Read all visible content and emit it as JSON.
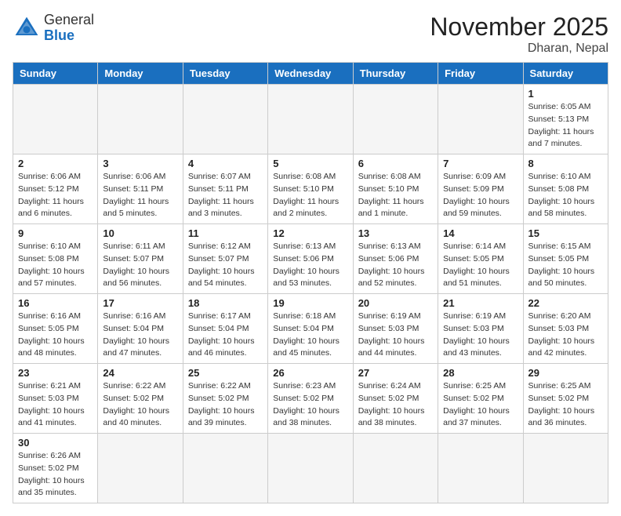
{
  "header": {
    "title": "November 2025",
    "location": "Dharan, Nepal",
    "logo_general": "General",
    "logo_blue": "Blue"
  },
  "weekdays": [
    "Sunday",
    "Monday",
    "Tuesday",
    "Wednesday",
    "Thursday",
    "Friday",
    "Saturday"
  ],
  "weeks": [
    [
      {
        "day": "",
        "sunrise": "",
        "sunset": "",
        "daylight": ""
      },
      {
        "day": "",
        "sunrise": "",
        "sunset": "",
        "daylight": ""
      },
      {
        "day": "",
        "sunrise": "",
        "sunset": "",
        "daylight": ""
      },
      {
        "day": "",
        "sunrise": "",
        "sunset": "",
        "daylight": ""
      },
      {
        "day": "",
        "sunrise": "",
        "sunset": "",
        "daylight": ""
      },
      {
        "day": "",
        "sunrise": "",
        "sunset": "",
        "daylight": ""
      },
      {
        "day": "1",
        "sunrise": "Sunrise: 6:05 AM",
        "sunset": "Sunset: 5:13 PM",
        "daylight": "Daylight: 11 hours and 7 minutes."
      }
    ],
    [
      {
        "day": "2",
        "sunrise": "Sunrise: 6:06 AM",
        "sunset": "Sunset: 5:12 PM",
        "daylight": "Daylight: 11 hours and 6 minutes."
      },
      {
        "day": "3",
        "sunrise": "Sunrise: 6:06 AM",
        "sunset": "Sunset: 5:11 PM",
        "daylight": "Daylight: 11 hours and 5 minutes."
      },
      {
        "day": "4",
        "sunrise": "Sunrise: 6:07 AM",
        "sunset": "Sunset: 5:11 PM",
        "daylight": "Daylight: 11 hours and 3 minutes."
      },
      {
        "day": "5",
        "sunrise": "Sunrise: 6:08 AM",
        "sunset": "Sunset: 5:10 PM",
        "daylight": "Daylight: 11 hours and 2 minutes."
      },
      {
        "day": "6",
        "sunrise": "Sunrise: 6:08 AM",
        "sunset": "Sunset: 5:10 PM",
        "daylight": "Daylight: 11 hours and 1 minute."
      },
      {
        "day": "7",
        "sunrise": "Sunrise: 6:09 AM",
        "sunset": "Sunset: 5:09 PM",
        "daylight": "Daylight: 10 hours and 59 minutes."
      },
      {
        "day": "8",
        "sunrise": "Sunrise: 6:10 AM",
        "sunset": "Sunset: 5:08 PM",
        "daylight": "Daylight: 10 hours and 58 minutes."
      }
    ],
    [
      {
        "day": "9",
        "sunrise": "Sunrise: 6:10 AM",
        "sunset": "Sunset: 5:08 PM",
        "daylight": "Daylight: 10 hours and 57 minutes."
      },
      {
        "day": "10",
        "sunrise": "Sunrise: 6:11 AM",
        "sunset": "Sunset: 5:07 PM",
        "daylight": "Daylight: 10 hours and 56 minutes."
      },
      {
        "day": "11",
        "sunrise": "Sunrise: 6:12 AM",
        "sunset": "Sunset: 5:07 PM",
        "daylight": "Daylight: 10 hours and 54 minutes."
      },
      {
        "day": "12",
        "sunrise": "Sunrise: 6:13 AM",
        "sunset": "Sunset: 5:06 PM",
        "daylight": "Daylight: 10 hours and 53 minutes."
      },
      {
        "day": "13",
        "sunrise": "Sunrise: 6:13 AM",
        "sunset": "Sunset: 5:06 PM",
        "daylight": "Daylight: 10 hours and 52 minutes."
      },
      {
        "day": "14",
        "sunrise": "Sunrise: 6:14 AM",
        "sunset": "Sunset: 5:05 PM",
        "daylight": "Daylight: 10 hours and 51 minutes."
      },
      {
        "day": "15",
        "sunrise": "Sunrise: 6:15 AM",
        "sunset": "Sunset: 5:05 PM",
        "daylight": "Daylight: 10 hours and 50 minutes."
      }
    ],
    [
      {
        "day": "16",
        "sunrise": "Sunrise: 6:16 AM",
        "sunset": "Sunset: 5:05 PM",
        "daylight": "Daylight: 10 hours and 48 minutes."
      },
      {
        "day": "17",
        "sunrise": "Sunrise: 6:16 AM",
        "sunset": "Sunset: 5:04 PM",
        "daylight": "Daylight: 10 hours and 47 minutes."
      },
      {
        "day": "18",
        "sunrise": "Sunrise: 6:17 AM",
        "sunset": "Sunset: 5:04 PM",
        "daylight": "Daylight: 10 hours and 46 minutes."
      },
      {
        "day": "19",
        "sunrise": "Sunrise: 6:18 AM",
        "sunset": "Sunset: 5:04 PM",
        "daylight": "Daylight: 10 hours and 45 minutes."
      },
      {
        "day": "20",
        "sunrise": "Sunrise: 6:19 AM",
        "sunset": "Sunset: 5:03 PM",
        "daylight": "Daylight: 10 hours and 44 minutes."
      },
      {
        "day": "21",
        "sunrise": "Sunrise: 6:19 AM",
        "sunset": "Sunset: 5:03 PM",
        "daylight": "Daylight: 10 hours and 43 minutes."
      },
      {
        "day": "22",
        "sunrise": "Sunrise: 6:20 AM",
        "sunset": "Sunset: 5:03 PM",
        "daylight": "Daylight: 10 hours and 42 minutes."
      }
    ],
    [
      {
        "day": "23",
        "sunrise": "Sunrise: 6:21 AM",
        "sunset": "Sunset: 5:03 PM",
        "daylight": "Daylight: 10 hours and 41 minutes."
      },
      {
        "day": "24",
        "sunrise": "Sunrise: 6:22 AM",
        "sunset": "Sunset: 5:02 PM",
        "daylight": "Daylight: 10 hours and 40 minutes."
      },
      {
        "day": "25",
        "sunrise": "Sunrise: 6:22 AM",
        "sunset": "Sunset: 5:02 PM",
        "daylight": "Daylight: 10 hours and 39 minutes."
      },
      {
        "day": "26",
        "sunrise": "Sunrise: 6:23 AM",
        "sunset": "Sunset: 5:02 PM",
        "daylight": "Daylight: 10 hours and 38 minutes."
      },
      {
        "day": "27",
        "sunrise": "Sunrise: 6:24 AM",
        "sunset": "Sunset: 5:02 PM",
        "daylight": "Daylight: 10 hours and 38 minutes."
      },
      {
        "day": "28",
        "sunrise": "Sunrise: 6:25 AM",
        "sunset": "Sunset: 5:02 PM",
        "daylight": "Daylight: 10 hours and 37 minutes."
      },
      {
        "day": "29",
        "sunrise": "Sunrise: 6:25 AM",
        "sunset": "Sunset: 5:02 PM",
        "daylight": "Daylight: 10 hours and 36 minutes."
      }
    ],
    [
      {
        "day": "30",
        "sunrise": "Sunrise: 6:26 AM",
        "sunset": "Sunset: 5:02 PM",
        "daylight": "Daylight: 10 hours and 35 minutes."
      },
      {
        "day": "",
        "sunrise": "",
        "sunset": "",
        "daylight": ""
      },
      {
        "day": "",
        "sunrise": "",
        "sunset": "",
        "daylight": ""
      },
      {
        "day": "",
        "sunrise": "",
        "sunset": "",
        "daylight": ""
      },
      {
        "day": "",
        "sunrise": "",
        "sunset": "",
        "daylight": ""
      },
      {
        "day": "",
        "sunrise": "",
        "sunset": "",
        "daylight": ""
      },
      {
        "day": "",
        "sunrise": "",
        "sunset": "",
        "daylight": ""
      }
    ]
  ]
}
